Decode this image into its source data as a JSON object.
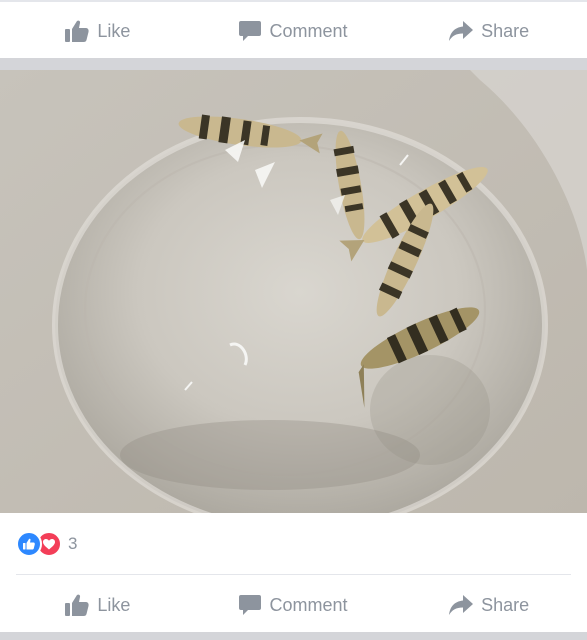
{
  "actions_top": {
    "like_label": "Like",
    "comment_label": "Comment",
    "share_label": "Share"
  },
  "photo": {
    "alt": ""
  },
  "reactions": {
    "types": [
      "like-icon",
      "love-icon"
    ],
    "count": "3"
  },
  "actions_bottom": {
    "like_label": "Like",
    "comment_label": "Comment",
    "share_label": "Share"
  },
  "colors": {
    "icon_gray": "#8d949e",
    "like_blue": "#2d88ff",
    "love_red": "#f33e58",
    "band_gray": "#d4d5d9"
  }
}
